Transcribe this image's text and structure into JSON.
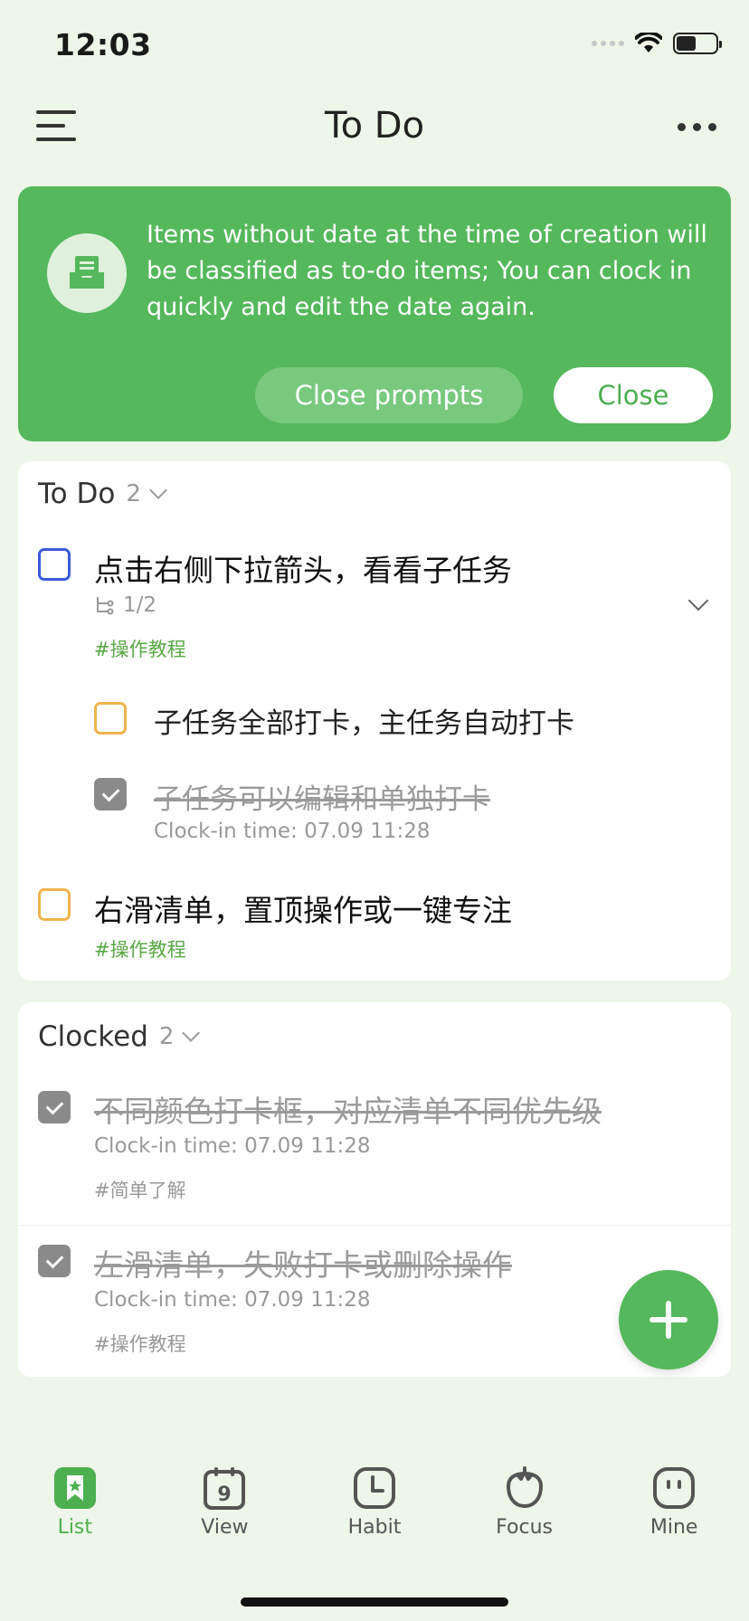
{
  "status_bar": {
    "time": "12:03"
  },
  "header": {
    "title": "To Do"
  },
  "banner": {
    "message": "Items without date at the time of creation will be classified as to-do items; You can clock in quickly and edit the date again.",
    "close_prompts_label": "Close prompts",
    "close_label": "Close"
  },
  "todo_section": {
    "title": "To Do",
    "count": "2",
    "tasks": [
      {
        "title": "点击右侧下拉箭头，看看子任务",
        "subtask_progress": "1/2",
        "tag": "#操作教程",
        "subtasks": [
          {
            "title": "子任务全部打卡，主任务自动打卡"
          },
          {
            "title": "子任务可以编辑和单独打卡",
            "clock_in": "Clock-in time: 07.09 11:28"
          }
        ]
      },
      {
        "title": "右滑清单，置顶操作或一键专注",
        "tag": "#操作教程"
      }
    ]
  },
  "clocked_section": {
    "title": "Clocked",
    "count": "2",
    "tasks": [
      {
        "title": "不同颜色打卡框，对应清单不同优先级",
        "clock_in": "Clock-in time: 07.09 11:28",
        "tag": "#简单了解"
      },
      {
        "title": "左滑清单，失败打卡或删除操作",
        "clock_in": "Clock-in time: 07.09 11:28",
        "tag": "#操作教程"
      }
    ]
  },
  "bottom_nav": {
    "items": [
      {
        "label": "List",
        "icon": "list-bookmark-icon",
        "active": true
      },
      {
        "label": "View",
        "icon": "calendar-icon",
        "active": false,
        "badge": "9"
      },
      {
        "label": "Habit",
        "icon": "clock-icon",
        "active": false
      },
      {
        "label": "Focus",
        "icon": "tomato-icon",
        "active": false
      },
      {
        "label": "Mine",
        "icon": "face-icon",
        "active": false
      }
    ]
  },
  "colors": {
    "accent_green": "#55b85c",
    "priority_blue": "#3b5bdb",
    "priority_orange": "#f0b44c",
    "tag_green": "#5aa846"
  }
}
